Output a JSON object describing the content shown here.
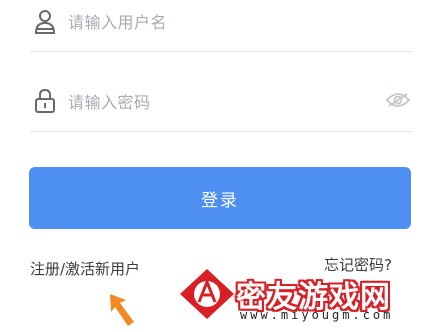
{
  "form": {
    "username": {
      "placeholder": "请输入用户名",
      "icon": "user-icon"
    },
    "password": {
      "placeholder": "请输入密码",
      "icon": "lock-icon",
      "toggle_icon": "eye-hidden-icon"
    },
    "login_label": "登录",
    "register_label": "注册/激活新用户",
    "forgot_label": "忘记密码?"
  },
  "watermark": {
    "name": "密友游戏网",
    "url": "www.miyougm.com"
  },
  "colors": {
    "accent": "#4d8ff2",
    "watermark_red": "#d81f26",
    "arrow": "#f08a24"
  }
}
